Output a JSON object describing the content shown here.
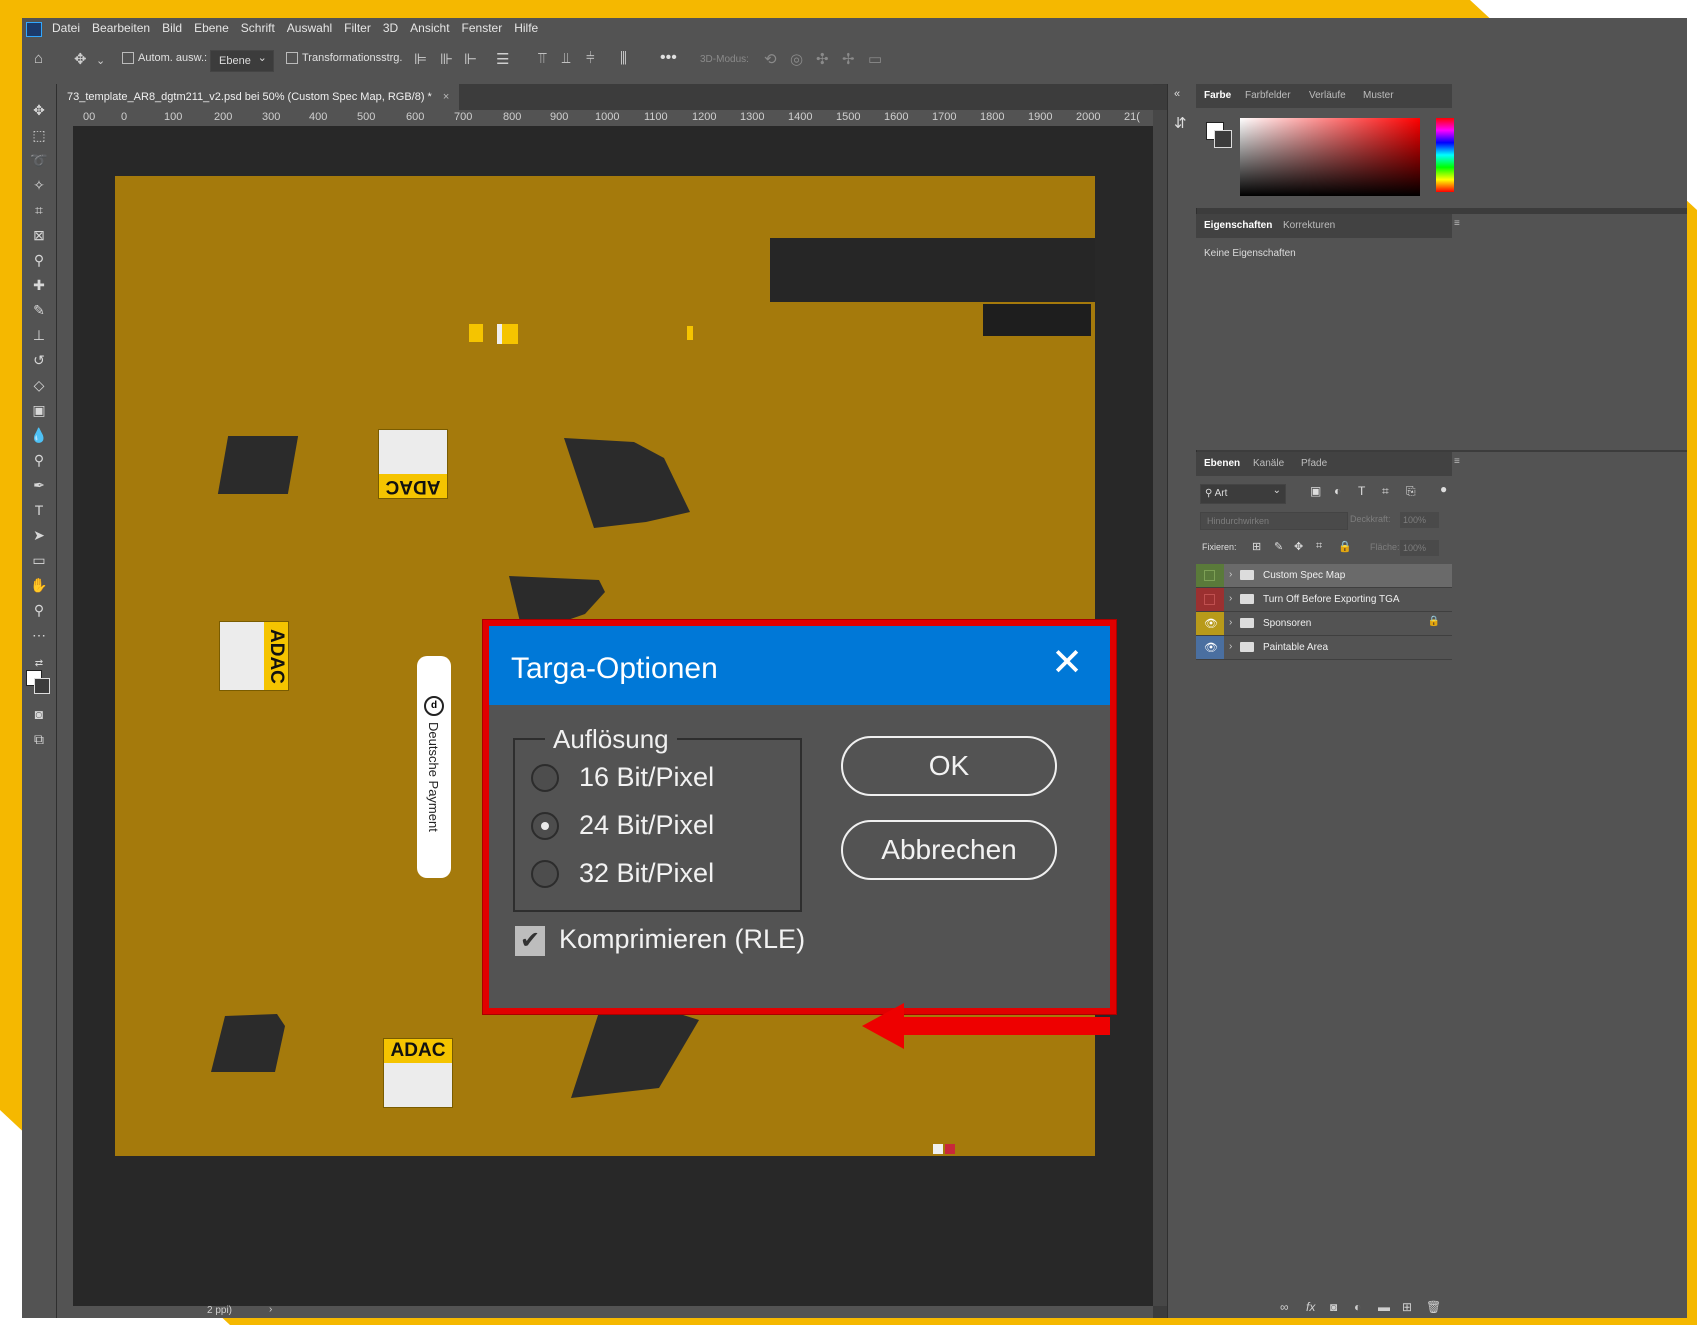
{
  "menu": [
    "Datei",
    "Bearbeiten",
    "Bild",
    "Ebene",
    "Schrift",
    "Auswahl",
    "Filter",
    "3D",
    "Ansicht",
    "Fenster",
    "Hilfe"
  ],
  "options_bar": {
    "auto_select_label": "Autom. ausw.:",
    "auto_select_value": "Ebene",
    "transform_label": "Transformationsstrg.",
    "mode_3d_label": "3D-Modus:",
    "more": "•••"
  },
  "document": {
    "tab_title": "73_template_AR8_dgtm211_v2.psd bei 50% (Custom Spec Map, RGB/8) *",
    "tab_close": "×",
    "ruler_h": [
      "00",
      "0",
      "100",
      "200",
      "300",
      "400",
      "500",
      "600",
      "700",
      "800",
      "900",
      "1000",
      "1100",
      "1200",
      "1300",
      "1400",
      "1500",
      "1600",
      "1700",
      "1800",
      "1900",
      "2000",
      "21("
    ],
    "status_text": "2 ppi)",
    "status_arrow": "›"
  },
  "canvas": {
    "adac_text": "ADAC",
    "sticker_text": "Deutsche Payment",
    "sticker_icon": "circle-d-logo-icon"
  },
  "panels": {
    "color_tabs": [
      "Farbe",
      "Farbfelder",
      "Verläufe",
      "Muster"
    ],
    "properties_tabs": [
      "Eigenschaften",
      "Korrekturen"
    ],
    "properties_empty": "Keine Eigenschaften",
    "layers_tabs": [
      "Ebenen",
      "Kanäle",
      "Pfade"
    ],
    "filter_label": "Art",
    "blend_mode": "Hindurchwirken",
    "opacity_label": "Deckkraft:",
    "opacity_value": "100%",
    "lock_label": "Fixieren:",
    "fill_label": "Fläche:",
    "fill_value": "100%",
    "layers": [
      {
        "name": "Custom Spec Map",
        "color": "#5a7a3a",
        "visible": false
      },
      {
        "name": "Turn Off Before Exporting TGA",
        "color": "#9b3030",
        "visible": false
      },
      {
        "name": "Sponsoren",
        "color": "#b89a1a",
        "visible": true,
        "locked": true
      },
      {
        "name": "Paintable Area",
        "color": "#4a6fa0",
        "visible": true
      }
    ]
  },
  "dialog": {
    "title": "Targa-Optionen",
    "close_label": "✕",
    "group_label": "Auflösung",
    "options": [
      "16 Bit/Pixel",
      "24 Bit/Pixel",
      "32 Bit/Pixel"
    ],
    "selected_index": 1,
    "ok_label": "OK",
    "cancel_label": "Abbrechen",
    "compress_label": "Komprimieren (RLE)",
    "compress_checked": true,
    "checkmark": "✔"
  },
  "colors": {
    "frame_yellow": "#f5b800",
    "canvas_gold": "#a57a0c",
    "dialog_title_blue": "#0078d7",
    "highlight_red": "#e10000"
  }
}
